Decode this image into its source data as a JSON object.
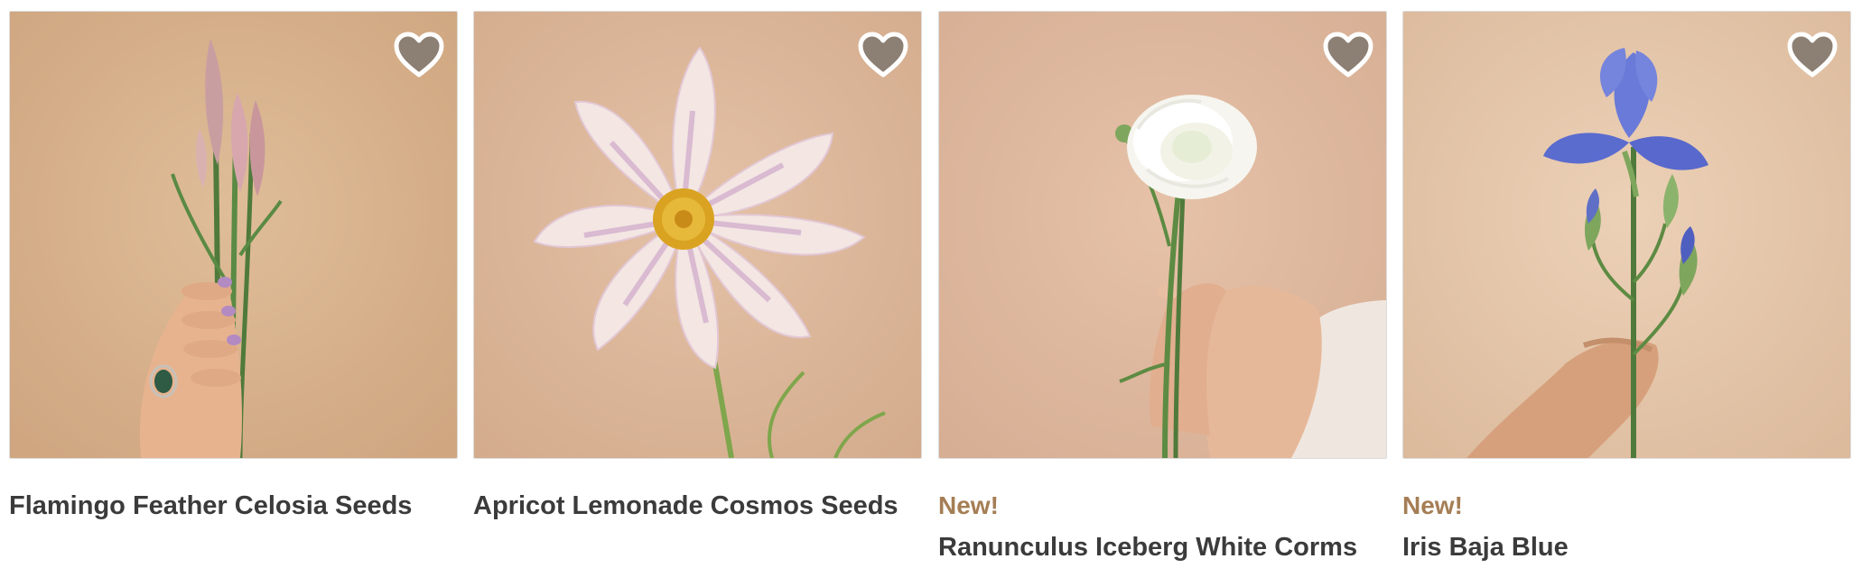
{
  "products": [
    {
      "title": "Flamingo Feather Celosia Seeds",
      "badge": "",
      "image_icon": "celosia-flower-image",
      "favorite_icon": "heart-icon",
      "bg": "#d9b48f"
    },
    {
      "title": "Apricot Lemonade Cosmos Seeds",
      "badge": "",
      "image_icon": "cosmos-flower-image",
      "favorite_icon": "heart-icon",
      "bg": "#ddb698"
    },
    {
      "title": "Ranunculus Iceberg White Corms",
      "badge": "New!",
      "image_icon": "ranunculus-flower-image",
      "favorite_icon": "heart-icon",
      "bg": "#e1b99f"
    },
    {
      "title": "Iris Baja Blue",
      "badge": "New!",
      "image_icon": "iris-flower-image",
      "favorite_icon": "heart-icon",
      "bg": "#e3c2a5"
    }
  ],
  "colors": {
    "heart_fill": "#8c7f73",
    "heart_stroke": "#ffffff",
    "badge": "#a57e55",
    "title": "#3b3b3b"
  }
}
